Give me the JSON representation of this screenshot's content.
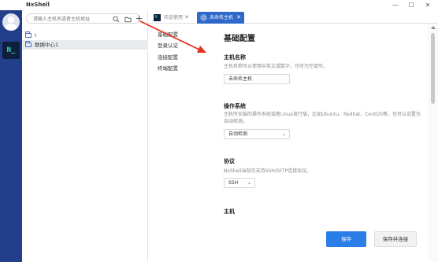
{
  "window": {
    "title": "NxShell",
    "minimize_glyph": "—",
    "maximize_glyph": "☐",
    "close_glyph": "✕"
  },
  "rail": {
    "app_icon_text": "N_"
  },
  "hosts": {
    "search_placeholder": "请输入主机名或者主机地址",
    "tree": [
      {
        "label": "I"
      },
      {
        "label": "数据中心1"
      }
    ]
  },
  "tabs": [
    {
      "label": "欢迎使用",
      "close": "✕",
      "active": false
    },
    {
      "label": "未命名主机",
      "close": "✕",
      "active": true
    }
  ],
  "settings_nav": {
    "items": [
      "基础配置",
      "登录认证",
      "连接配置",
      "终端配置"
    ]
  },
  "content": {
    "page_title": "基础配置",
    "sections": [
      {
        "title": "主机名称",
        "desc": "主机名称可以使用中英文或数字，也可为空填写。",
        "value": "未命名主机"
      },
      {
        "title": "操作系统",
        "desc": "主机所安装的操作系统或者Linux发行版，比如Ubuntu、Redhat、CentOS等，也可以设置为自动检测。",
        "value": "自动检测"
      },
      {
        "title": "协议",
        "desc": "NxShell当前仅支持SSH/SFTP连接协议。",
        "value": "SSH"
      },
      {
        "title": "主机",
        "desc": "",
        "value": ""
      }
    ]
  },
  "footer": {
    "save_label": "保存",
    "save_connect_label": "保存并连接"
  },
  "colors": {
    "rail": "#233e8b",
    "accent": "#2f68c9",
    "primary_button": "#2b7de8",
    "annotation_arrow": "#e0321e"
  }
}
